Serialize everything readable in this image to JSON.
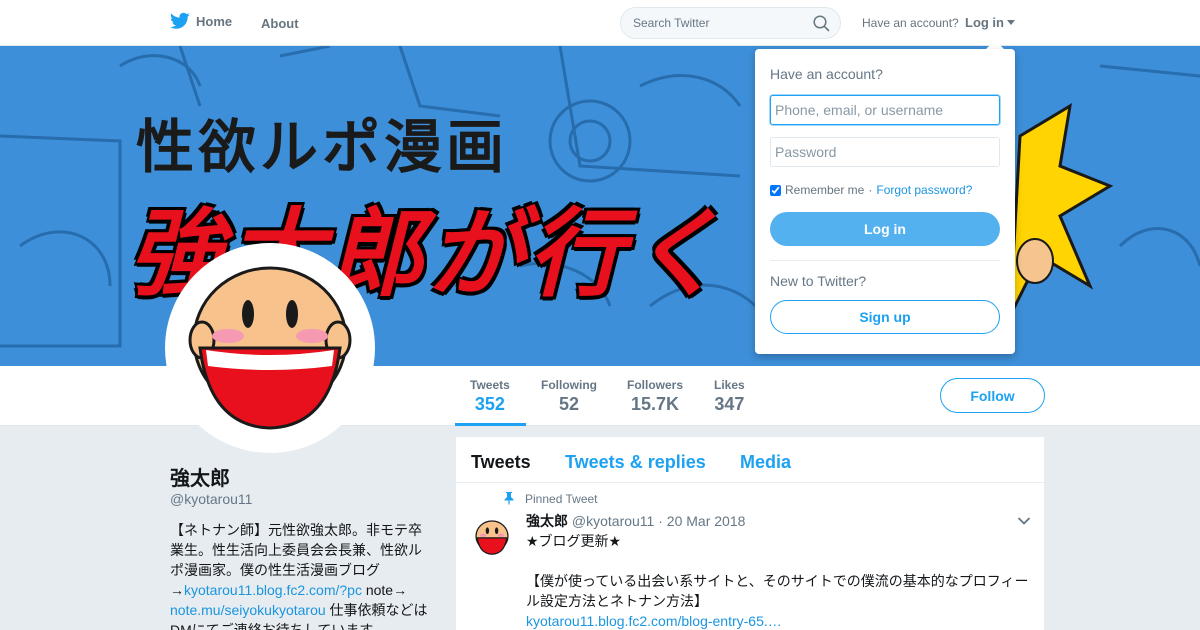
{
  "nav": {
    "home_label": "Home",
    "about_label": "About",
    "search_placeholder": "Search Twitter",
    "have_account": "Have an account?",
    "login_label": "Log in"
  },
  "banner": {
    "line1": "性欲ルポ漫画",
    "line2": "強太郎が行く"
  },
  "stats": [
    {
      "label": "Tweets",
      "value": "352"
    },
    {
      "label": "Following",
      "value": "52"
    },
    {
      "label": "Followers",
      "value": "15.7K"
    },
    {
      "label": "Likes",
      "value": "347"
    }
  ],
  "follow_label": "Follow",
  "profile": {
    "name": "強太郎",
    "handle": "@kyotarou11",
    "bio_text": "【ネトナン師】元性欲強太郎。非モテ卒業生。性生活向上委員会会長兼、性欲ルポ漫画家。僕の性生活漫画ブログ→",
    "bio_link1": "kyotarou11.blog.fc2.com/?pc",
    "bio_mid": " note→",
    "bio_link2": "note.mu/seiyokukyotarou",
    "bio_tail": " 仕事依頼などはDMにてご連絡お待ちしています。"
  },
  "timeline": {
    "tabs": [
      "Tweets",
      "Tweets & replies",
      "Media"
    ],
    "pinned_label": "Pinned Tweet",
    "tweet": {
      "name": "強太郎",
      "handle": "@kyotarou11",
      "separator": " · ",
      "date": "20 Mar 2018",
      "line1": "★ブログ更新★",
      "line2": "【僕が使っている出会い系サイトと、そのサイトでの僕流の基本的なプロフィール設定方法とネトナン方法】",
      "link": "kyotarou11.blog.fc2.com/blog-entry-65.…"
    }
  },
  "login_dropdown": {
    "title": "Have an account?",
    "username_placeholder": "Phone, email, or username",
    "password_placeholder": "Password",
    "remember_label": "Remember me",
    "separator": "·",
    "forgot_label": "Forgot password?",
    "login_button": "Log in",
    "new_label": "New to Twitter?",
    "signup_button": "Sign up"
  },
  "colors": {
    "accent": "#1da1f2",
    "banner_bg": "#3d8fd9",
    "banner_red": "#e8101c",
    "page_bg": "#e6ecf0"
  }
}
